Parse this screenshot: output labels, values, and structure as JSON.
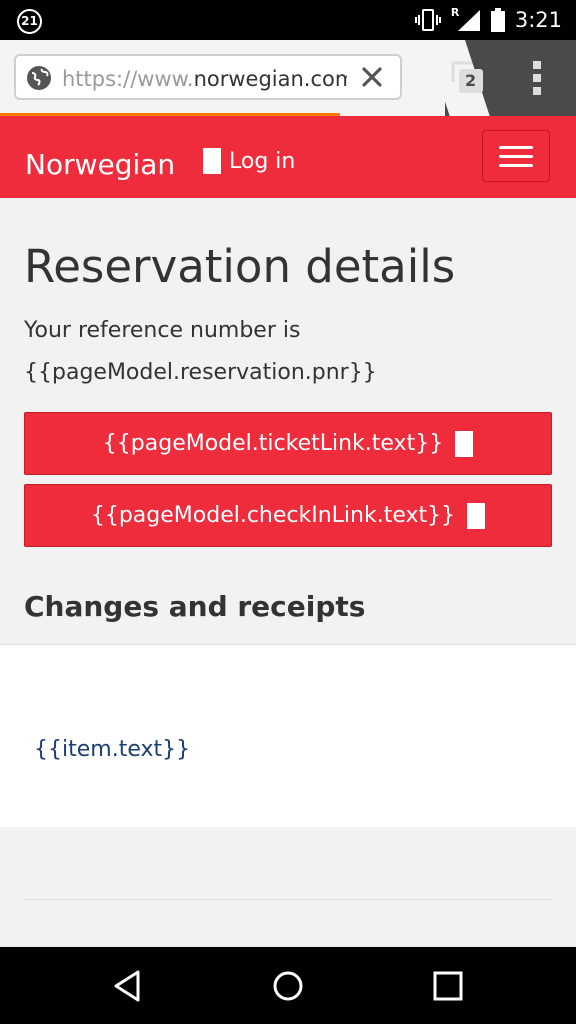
{
  "status_bar": {
    "notification_count": "21",
    "signal_label": "R",
    "time": "3:21"
  },
  "browser": {
    "url_scheme": "https://www.",
    "url_host": "norwegian.com",
    "tab_count": "2",
    "load_progress": 0.59
  },
  "header": {
    "brand": "Norwegian",
    "login_label": "Log in"
  },
  "main": {
    "title": "Reservation details",
    "reference_intro": "Your reference number is",
    "reference_value": "{{pageModel.reservation.pnr}}",
    "ticket_button": "{{pageModel.ticketLink.text}}",
    "checkin_button": "{{pageModel.checkInLink.text}}",
    "changes_title": "Changes and receipts",
    "receipt_item": "{{item.text}}"
  },
  "colors": {
    "brand_red": "#ee2c3c",
    "link_blue": "#1c3f73",
    "progress_orange": "#ff7a00"
  },
  "icons": [
    "globe-icon",
    "clear-icon",
    "tabs-icon",
    "overflow-menu-icon",
    "hamburger-icon",
    "back-icon",
    "home-icon",
    "recents-icon",
    "vibrate-icon",
    "signal-icon",
    "battery-icon"
  ]
}
